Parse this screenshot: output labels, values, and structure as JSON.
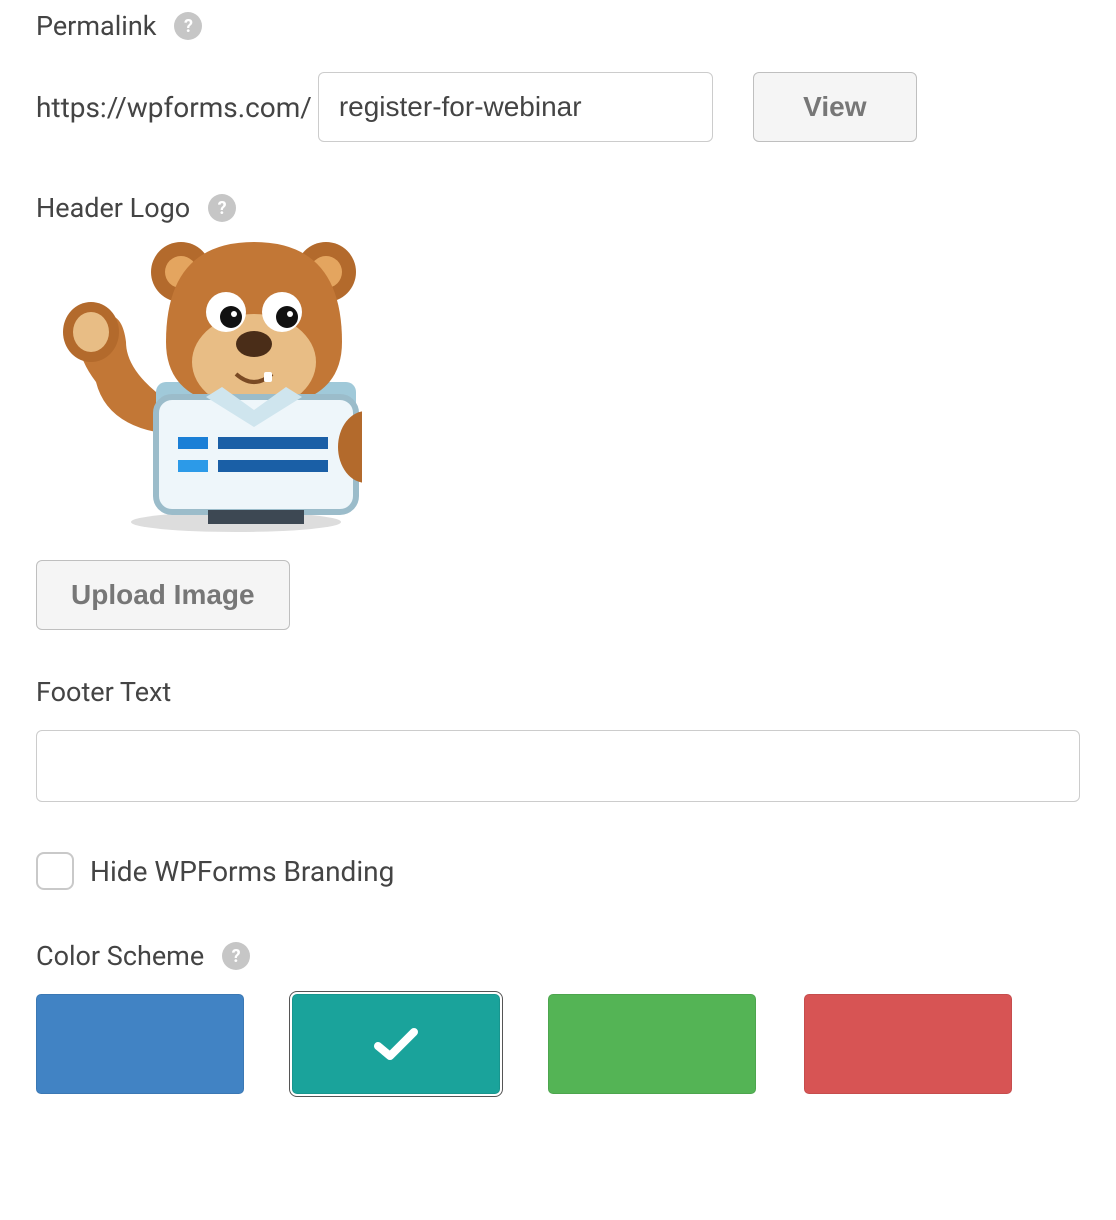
{
  "permalink": {
    "label": "Permalink",
    "base": "https://wpforms.com/",
    "slug": "register-for-webinar",
    "view_label": "View"
  },
  "header_logo": {
    "label": "Header Logo",
    "upload_label": "Upload Image"
  },
  "footer_text": {
    "label": "Footer Text",
    "value": ""
  },
  "hide_branding": {
    "label": "Hide WPForms Branding",
    "checked": false
  },
  "color_scheme": {
    "label": "Color Scheme",
    "options": [
      {
        "color": "#4183c4",
        "selected": false
      },
      {
        "color": "#1aa39b",
        "selected": true
      },
      {
        "color": "#54b455",
        "selected": false
      },
      {
        "color": "#d75454",
        "selected": false
      }
    ]
  }
}
